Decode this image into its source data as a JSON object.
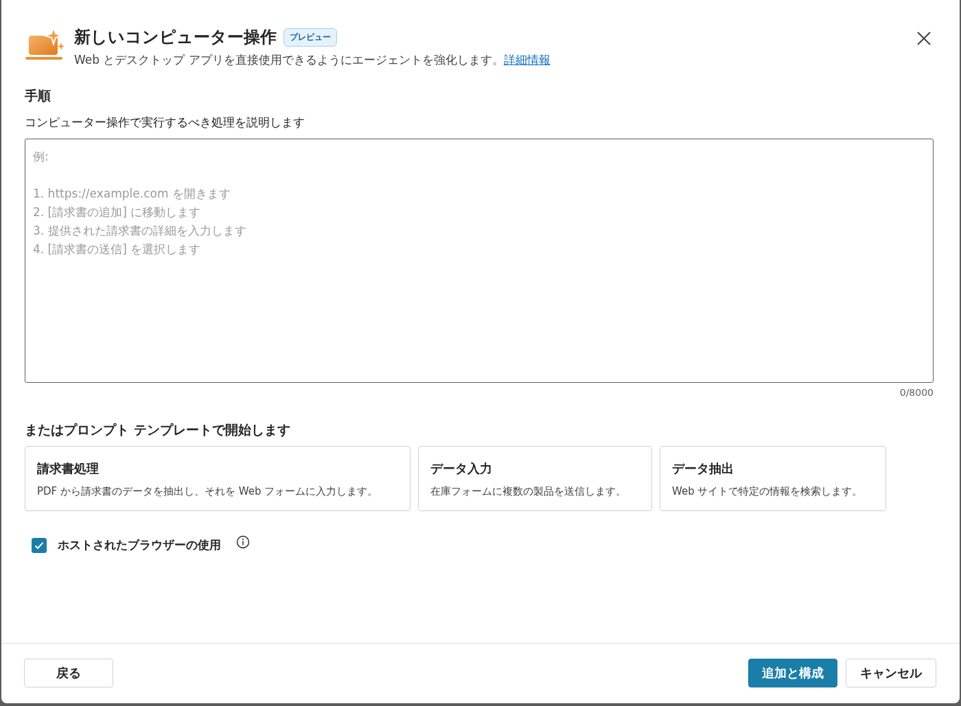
{
  "dialog": {
    "title": "新しいコンピューター操作",
    "badge": "プレビュー",
    "subtitle": "Web とデスクトップ アプリを直接使用できるようにエージェントを強化します。",
    "learn_more_link": "詳細情報"
  },
  "instructions": {
    "label": "手順",
    "description": "コンピューター操作で実行するべき処理を説明します",
    "placeholder": "例:\n\n1. https://example.com を開きます\n2. [請求書の追加] に移動します\n3. 提供された請求書の詳細を入力します\n4. [請求書の送信] を選択します",
    "counter": "0/8000"
  },
  "templates": {
    "heading": "またはプロンプト テンプレートで開始します",
    "cards": [
      {
        "title": "請求書処理",
        "description": "PDF から請求書のデータを抽出し、それを Web フォームに入力します。"
      },
      {
        "title": "データ入力",
        "description": "在庫フォームに複数の製品を送信します。"
      },
      {
        "title": "データ抽出",
        "description": "Web サイトで特定の情報を検索します。"
      }
    ]
  },
  "hosted_browser": {
    "label": "ホストされたブラウザーの使用",
    "checked": true
  },
  "footer": {
    "back_button": "戻る",
    "primary_button": "追加と構成",
    "cancel_button": "キャンセル"
  }
}
